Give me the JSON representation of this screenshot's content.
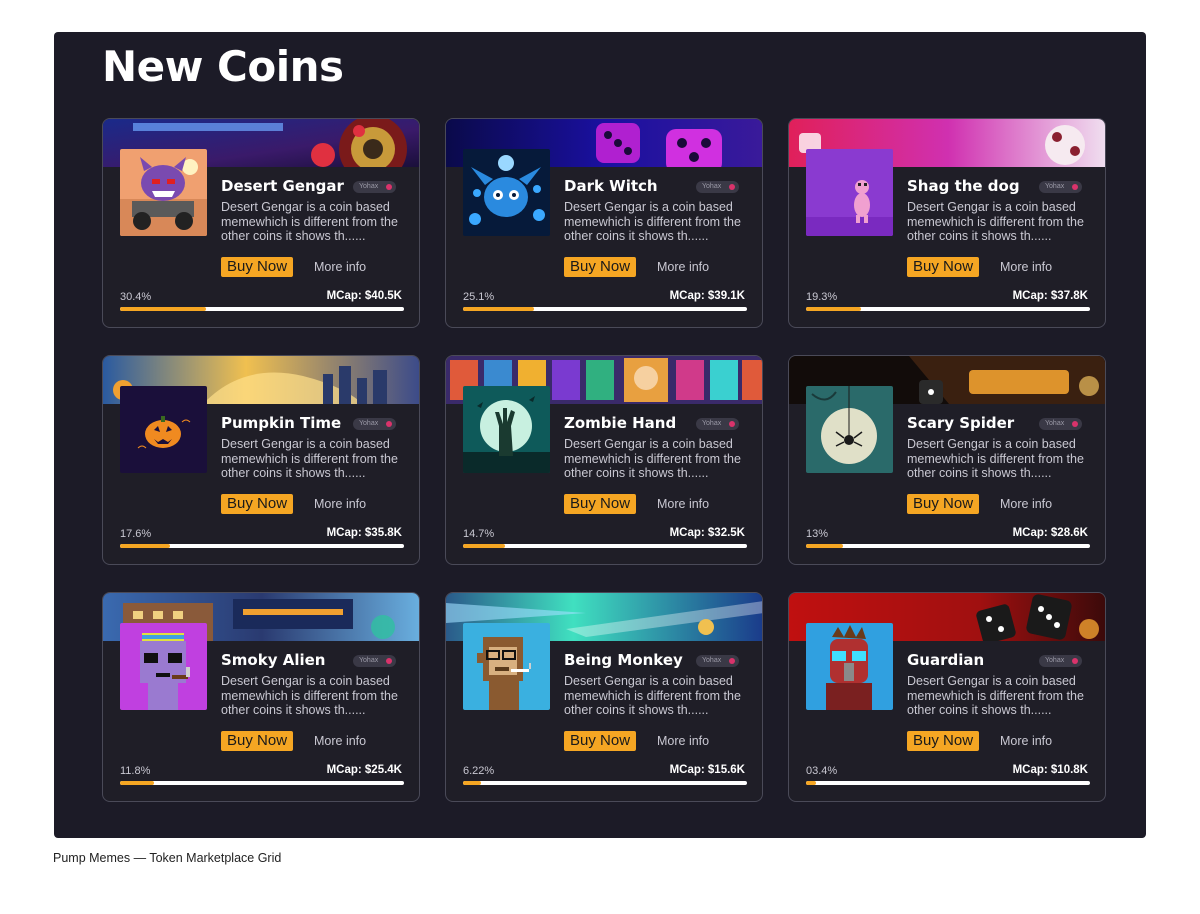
{
  "page": {
    "heading": "New Coins",
    "caption": "Pump Memes — Token Marketplace Grid"
  },
  "colors": {
    "panel_bg": "#1c1b27",
    "card_bg": "#1f1e27",
    "accent": "#f5a623",
    "progress_track": "#ffffff"
  },
  "cards": [
    {
      "name": "Desert Gengar",
      "tag": "Yohax",
      "description": "Desert Gengar is a coin based memewhich is different from the other coins it shows th......",
      "buy_label": "Buy Now",
      "more_label": "More info",
      "progress_label": "30.4%",
      "progress": 0.304,
      "mcap": "MCap: $40.5K",
      "thumb_icon": "purple-ghost-on-cart-icon",
      "banner_icon": "casino-roulette-banner"
    },
    {
      "name": "Dark Witch",
      "tag": "Yohax",
      "description": "Desert Gengar is a coin based memewhich is different from the other coins it shows th......",
      "buy_label": "Buy Now",
      "more_label": "More info",
      "progress_label": "25.1%",
      "progress": 0.251,
      "mcap": "MCap: $39.1K",
      "thumb_icon": "blue-creature-icon",
      "banner_icon": "purple-dice-banner"
    },
    {
      "name": "Shag the dog",
      "tag": "Yohax",
      "description": "Desert Gengar is a coin based memewhich is different from the other coins it shows th......",
      "buy_label": "Buy Now",
      "more_label": "More info",
      "progress_label": "19.3%",
      "progress": 0.193,
      "mcap": "MCap: $37.8K",
      "thumb_icon": "pink-dog-icon",
      "banner_icon": "pink-dice-banner"
    },
    {
      "name": "Pumpkin Time",
      "tag": "Yohax",
      "description": "Desert Gengar is a coin based memewhich is different from the other coins it shows th......",
      "buy_label": "Buy Now",
      "more_label": "More info",
      "progress_label": "17.6%",
      "progress": 0.176,
      "mcap": "MCap: $35.8K",
      "thumb_icon": "pumpkin-icon",
      "banner_icon": "golden-city-banner"
    },
    {
      "name": "Zombie Hand",
      "tag": "Yohax",
      "description": "Desert Gengar is a coin based memewhich is different from the other coins it shows th......",
      "buy_label": "Buy Now",
      "more_label": "More info",
      "progress_label": "14.7%",
      "progress": 0.147,
      "mcap": "MCap: $32.5K",
      "thumb_icon": "zombie-hand-icon",
      "banner_icon": "crypto-cards-banner"
    },
    {
      "name": "Scary Spider",
      "tag": "Yohax",
      "description": "Desert Gengar is a coin based memewhich is different from the other coins it shows th......",
      "buy_label": "Buy Now",
      "more_label": "More info",
      "progress_label": "13%",
      "progress": 0.13,
      "mcap": "MCap: $28.6K",
      "thumb_icon": "spider-moon-icon",
      "banner_icon": "casino-sign-banner"
    },
    {
      "name": "Smoky Alien",
      "tag": "Yohax",
      "description": "Desert Gengar is a coin based memewhich is different from the other coins it shows th......",
      "buy_label": "Buy Now",
      "more_label": "More info",
      "progress_label": "11.8%",
      "progress": 0.118,
      "mcap": "MCap: $25.4K",
      "thumb_icon": "pixel-alien-icon",
      "banner_icon": "casino-building-banner"
    },
    {
      "name": "Being Monkey",
      "tag": "Yohax",
      "description": "Desert Gengar is a coin based memewhich is different from the other coins it shows th......",
      "buy_label": "Buy Now",
      "more_label": "More info",
      "progress_label": "6.22%",
      "progress": 0.0622,
      "mcap": "MCap: $15.6K",
      "thumb_icon": "pixel-monkey-icon",
      "banner_icon": "rocket-speed-banner"
    },
    {
      "name": "Guardian",
      "tag": "Yohax",
      "description": "Desert Gengar is a coin based memewhich is different from the other coins it shows th......",
      "buy_label": "Buy Now",
      "more_label": "More info",
      "progress_label": "03.4%",
      "progress": 0.034,
      "mcap": "MCap: $10.8K",
      "thumb_icon": "masked-hero-icon",
      "banner_icon": "red-dice-banner"
    }
  ]
}
